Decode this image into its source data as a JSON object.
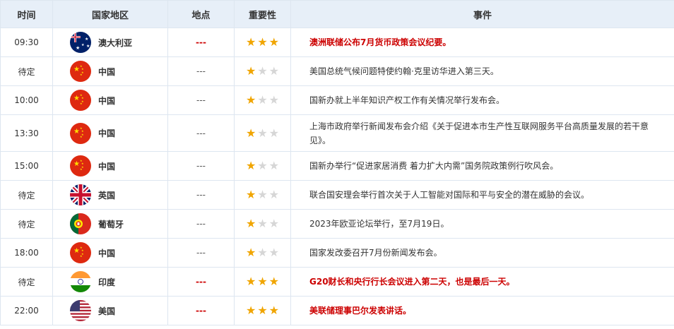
{
  "header": {
    "time": "时间",
    "country": "国家地区",
    "location": "地点",
    "importance": "重要性",
    "event": "事件"
  },
  "colors": {
    "important": "#cc0000",
    "star_on": "#f0a500",
    "star_off": "#d6d6d6",
    "header_bg": "#e7eff8"
  },
  "rows": [
    {
      "time": "09:30",
      "country": "澳大利亚",
      "flag": "australia-flag-icon",
      "location": "---",
      "stars": 3,
      "event": "澳洲联储公布7月货币政策会议纪要。",
      "important": true
    },
    {
      "time": "待定",
      "country": "中国",
      "flag": "china-flag-icon",
      "location": "---",
      "stars": 1,
      "event": "美国总统气候问题特使约翰·克里访华进入第三天。",
      "important": false
    },
    {
      "time": "10:00",
      "country": "中国",
      "flag": "china-flag-icon",
      "location": "---",
      "stars": 1,
      "event": "国新办就上半年知识产权工作有关情况举行发布会。",
      "important": false
    },
    {
      "time": "13:30",
      "country": "中国",
      "flag": "china-flag-icon",
      "location": "---",
      "stars": 1,
      "event": "上海市政府举行新闻发布会介绍《关于促进本市生产性互联网服务平台高质量发展的若干意见》。",
      "important": false
    },
    {
      "time": "15:00",
      "country": "中国",
      "flag": "china-flag-icon",
      "location": "---",
      "stars": 1,
      "event": "国新办举行“促进家居消费 着力扩大内需”国务院政策例行吹风会。",
      "important": false
    },
    {
      "time": "待定",
      "country": "英国",
      "flag": "uk-flag-icon",
      "location": "---",
      "stars": 1,
      "event": "联合国安理会举行首次关于人工智能对国际和平与安全的潜在威胁的会议。",
      "important": false
    },
    {
      "time": "待定",
      "country": "葡萄牙",
      "flag": "portugal-flag-icon",
      "location": "---",
      "stars": 1,
      "event": "2023年欧亚论坛举行，至7月19日。",
      "important": false
    },
    {
      "time": "18:00",
      "country": "中国",
      "flag": "china-flag-icon",
      "location": "---",
      "stars": 1,
      "event": "国家发改委召开7月份新闻发布会。",
      "important": false
    },
    {
      "time": "待定",
      "country": "印度",
      "flag": "india-flag-icon",
      "location": "---",
      "stars": 3,
      "event": "G20财长和央行行长会议进入第二天，也是最后一天。",
      "important": true
    },
    {
      "time": "22:00",
      "country": "美国",
      "flag": "usa-flag-icon",
      "location": "---",
      "stars": 3,
      "event": "美联储理事巴尔发表讲话。",
      "important": true
    }
  ]
}
